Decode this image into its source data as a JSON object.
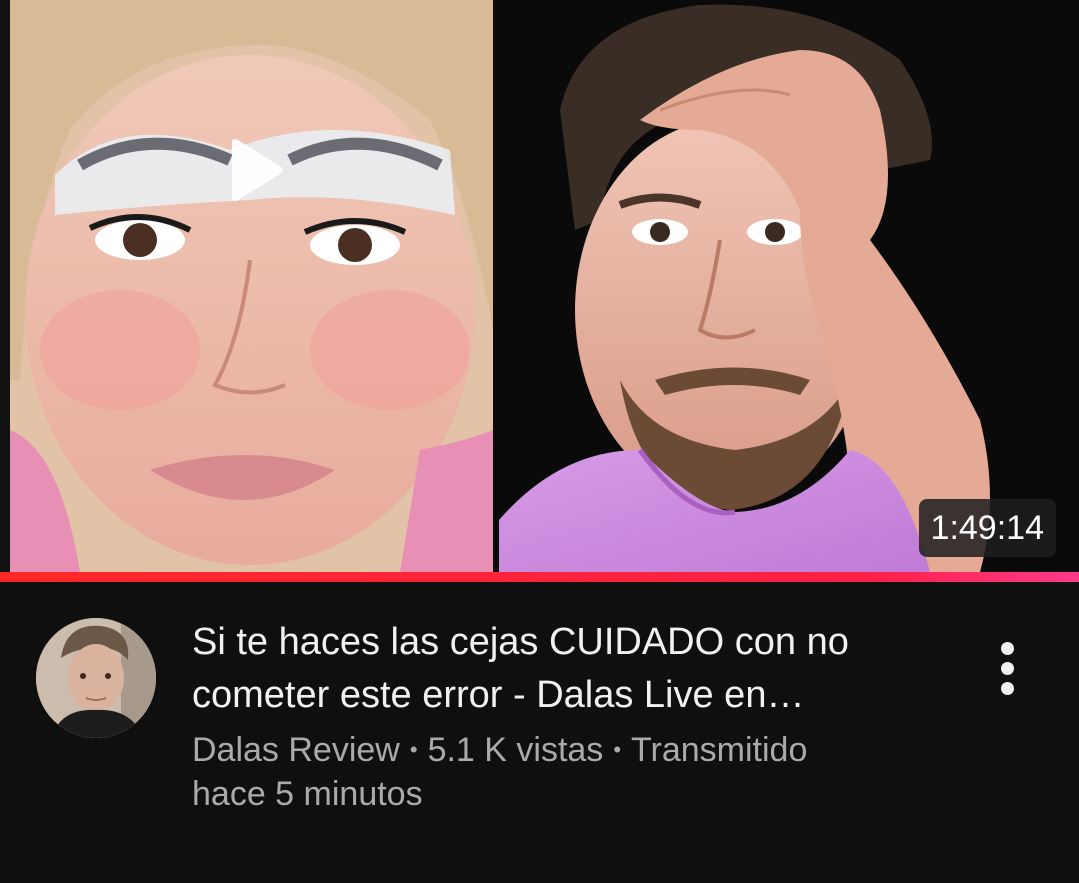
{
  "video": {
    "duration": "1:49:14",
    "title_line1": "Si te haces las cejas CUIDADO con no",
    "title_line2": "cometer este error - Dalas Live en…",
    "channel": "Dalas Review",
    "views": "5.1 K vistas",
    "streamed_prefix": "Transmitido",
    "streamed_time": "hace 5 minutos",
    "separator": "•",
    "watch_progress": 1.0
  },
  "icons": {
    "thumbnail_play": "play-icon",
    "more_actions": "more-vert-icon"
  },
  "colors": {
    "background": "#0f0f0f",
    "title": "#f1f1f1",
    "meta": "#aaaaaa",
    "progress": "#ff2046"
  }
}
